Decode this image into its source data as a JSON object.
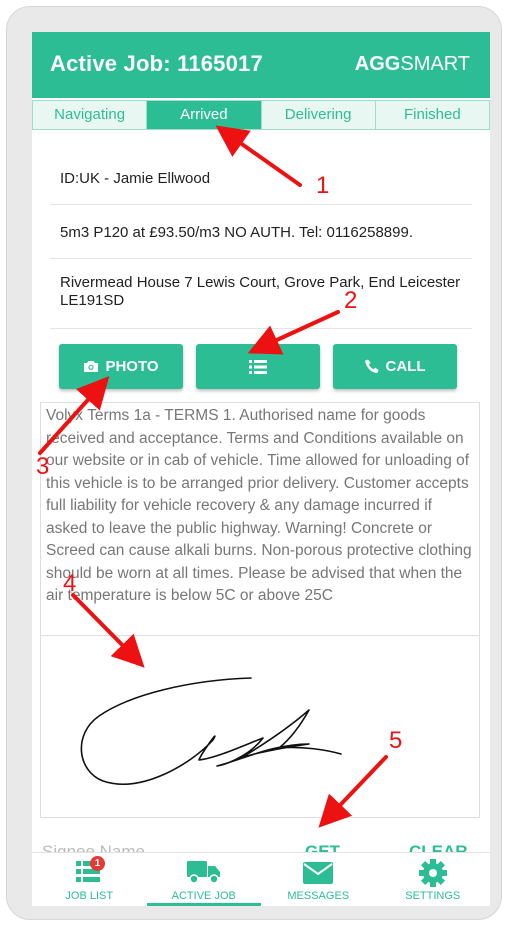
{
  "header": {
    "title": "Active Job: 1165017",
    "logo_bold": "AGG",
    "logo_rest": "SMART"
  },
  "tabs": [
    {
      "label": "Navigating",
      "active": false
    },
    {
      "label": "Arrived",
      "active": true
    },
    {
      "label": "Delivering",
      "active": false
    },
    {
      "label": "Finished",
      "active": false
    }
  ],
  "job": {
    "customer_id": "ID:UK - Jamie Ellwood",
    "order": "5m3 P120 at £93.50/m3 NO AUTH. Tel: 0116258899.",
    "address": "Rivermead House 7 Lewis Court, Grove Park, End Leicester LE191SD"
  },
  "actions": {
    "photo_label": "PHOTO",
    "call_label": "CALL"
  },
  "terms_text": "Volyx Terms 1a - TERMS 1. Authorised name for goods received and acceptance. Terms and Conditions available on our website or in cab of vehicle. Time allowed for unloading of this vehicle is to be arranged prior delivery. Customer accepts full liability for vehicle recovery & any damage incurred if asked to leave the public highway. Warning! Concrete or Screed can cause alkali burns. Non-porous protective clothing should be worn at all times. Please be advised that when the air temperature is below 5C or above 25C",
  "signature": {
    "signee_label": "Signee Name",
    "get_label": "GET",
    "clear_label": "CLEAR"
  },
  "bottom_nav": [
    {
      "label": "JOB LIST",
      "icon": "list-icon",
      "badge": "1",
      "active": false
    },
    {
      "label": "ACTIVE JOB",
      "icon": "truck-icon",
      "active": true
    },
    {
      "label": "MESSAGES",
      "icon": "envelope-icon",
      "active": false
    },
    {
      "label": "SETTINGS",
      "icon": "gear-icon",
      "active": false
    }
  ],
  "annotations": [
    "1",
    "2",
    "3",
    "4",
    "5"
  ],
  "colors": {
    "accent": "#2dbd94",
    "annotation": "#ee1111",
    "badge": "#e53935"
  }
}
